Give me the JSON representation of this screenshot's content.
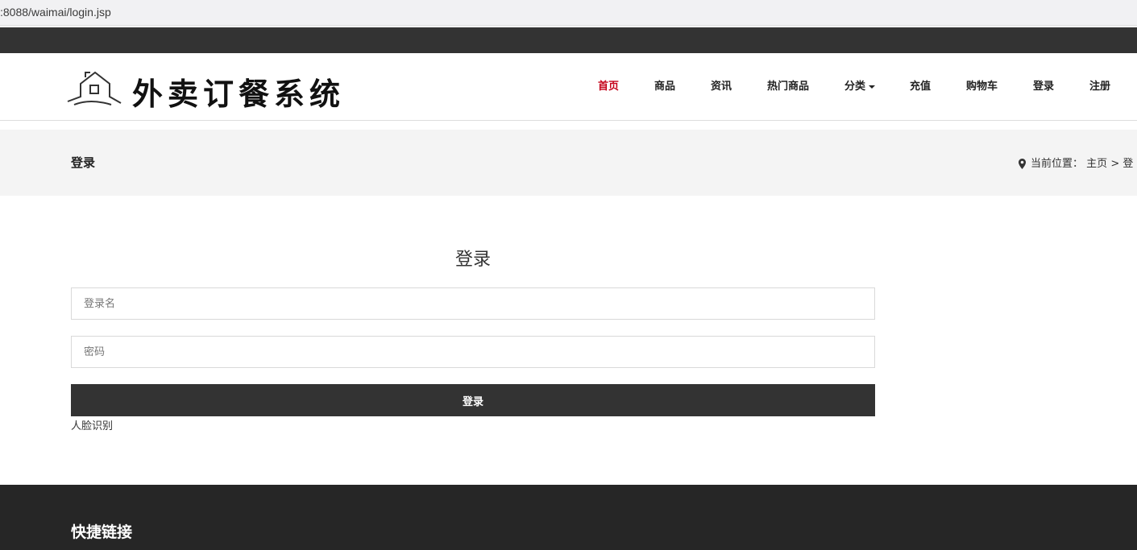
{
  "browser": {
    "url": ":8088/waimai/login.jsp"
  },
  "header": {
    "logo_text": "外卖订餐系统",
    "nav": [
      {
        "label": "首页",
        "active": true
      },
      {
        "label": "商品"
      },
      {
        "label": "资讯"
      },
      {
        "label": "热门商品"
      },
      {
        "label": "分类",
        "dropdown": true
      },
      {
        "label": "充值"
      },
      {
        "label": "购物车"
      },
      {
        "label": "登录"
      },
      {
        "label": "注册"
      }
    ],
    "active_color": "#c40018"
  },
  "titleband": {
    "title": "登录",
    "breadcrumb_prefix": "当前位置：",
    "breadcrumb_home": "主页",
    "breadcrumb_sep": ">",
    "breadcrumb_current": "登"
  },
  "login": {
    "title": "登录",
    "username_placeholder": "登录名",
    "password_placeholder": "密码",
    "submit_label": "登录",
    "face_link": "人脸识别"
  },
  "footer": {
    "title": "快捷链接"
  }
}
